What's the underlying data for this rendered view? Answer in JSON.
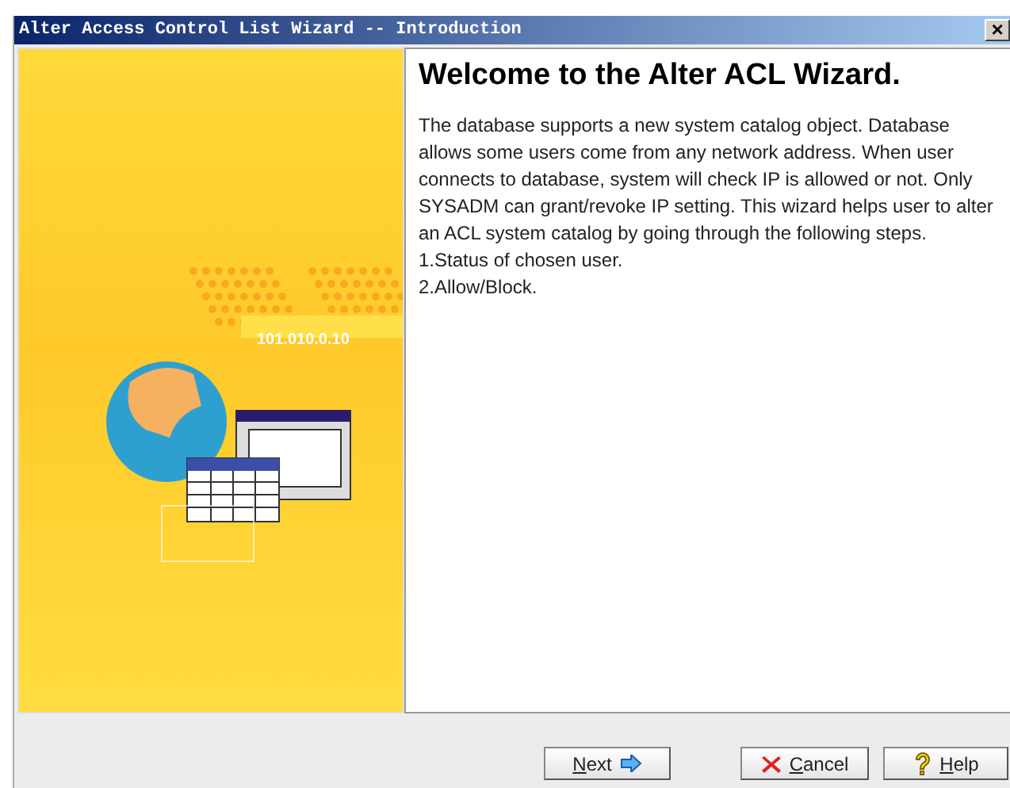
{
  "window": {
    "title": "Alter Access Control List Wizard -- Introduction",
    "close": "×"
  },
  "illustration": {
    "address": "101.010.0.10"
  },
  "content": {
    "heading": "Welcome to the Alter ACL Wizard.",
    "paragraph": " The database supports a new system catalog object. Database allows some users come from any network address. When user connects to database, system will check IP is allowed or not. Only SYSADM can grant/revoke IP setting. This wizard helps user to alter an ACL system catalog by going through the following steps.",
    "steps": [
      "1.Status of chosen user.",
      "2.Allow/Block."
    ]
  },
  "buttons": [
    {
      "kind": "next",
      "label": "Next"
    },
    {
      "kind": "cancel",
      "label": "Cancel"
    },
    {
      "kind": "help",
      "label": "Help"
    }
  ]
}
